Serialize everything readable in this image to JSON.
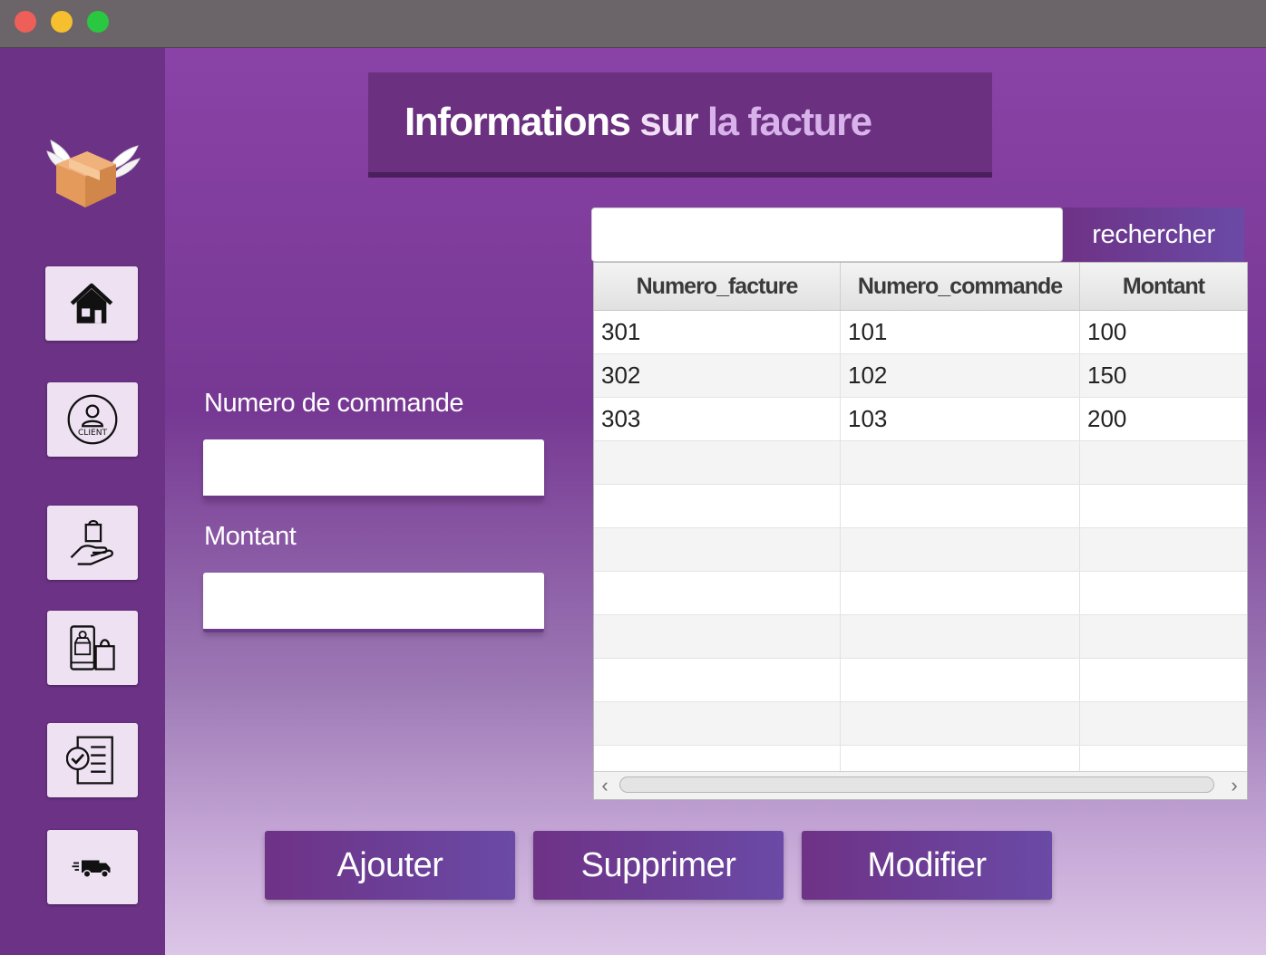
{
  "window": {
    "controls": [
      "close",
      "minimize",
      "zoom"
    ]
  },
  "sidebar": {
    "logo_icon": "flying-box-logo-icon",
    "items": [
      {
        "icon": "home-icon"
      },
      {
        "icon": "client-icon",
        "text": "CLIENT"
      },
      {
        "icon": "hand-bag-icon"
      },
      {
        "icon": "shop-phone-icon"
      },
      {
        "icon": "checklist-invoice-icon"
      },
      {
        "icon": "delivery-truck-icon"
      }
    ]
  },
  "header": {
    "title_part1": "Informations",
    "title_part2": "sur",
    "title_part3": "la facture"
  },
  "form": {
    "order_number_label": "Numero de commande",
    "order_number_value": "",
    "amount_label": "Montant",
    "amount_value": ""
  },
  "search": {
    "value": "",
    "button_label": "rechercher"
  },
  "table": {
    "columns": [
      "Numero_facture",
      "Numero_commande",
      "Montant"
    ],
    "rows": [
      [
        "301",
        "101",
        "100"
      ],
      [
        "302",
        "102",
        "150"
      ],
      [
        "303",
        "103",
        "200"
      ]
    ]
  },
  "actions": {
    "add_label": "Ajouter",
    "delete_label": "Supprimer",
    "edit_label": "Modifier"
  },
  "colors": {
    "sidebar": "#6c3286",
    "accent": "#6e3286",
    "title_panel": "#6b307f"
  }
}
